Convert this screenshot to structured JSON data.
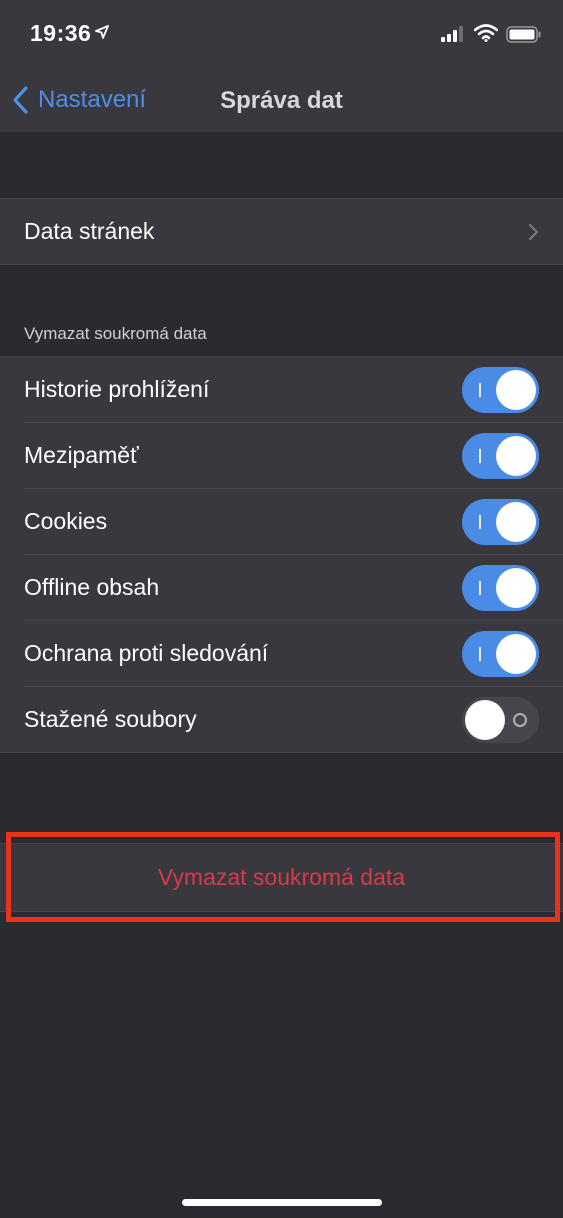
{
  "status": {
    "time": "19:36",
    "location_icon": "location-arrow-icon",
    "signal_icon": "cellular-signal-icon",
    "wifi_icon": "wifi-icon",
    "battery_icon": "battery-icon"
  },
  "nav": {
    "back_label": "Nastavení",
    "title": "Správa dat",
    "accent_color": "#4c8fe4"
  },
  "site_data": {
    "label": "Data stránek"
  },
  "section": {
    "header": "Vymazat soukromá data"
  },
  "toggles": [
    {
      "label": "Historie prohlížení",
      "on": true
    },
    {
      "label": "Mezipaměť",
      "on": true
    },
    {
      "label": "Cookies",
      "on": true
    },
    {
      "label": "Offline obsah",
      "on": true
    },
    {
      "label": "Ochrana proti sledování",
      "on": true
    },
    {
      "label": "Stažené soubory",
      "on": false
    }
  ],
  "clear_button": {
    "label": "Vymazat soukromá data",
    "color": "#d73a49"
  },
  "colors": {
    "toggle_on": "#4a8be6",
    "highlight": "#e8321e"
  }
}
